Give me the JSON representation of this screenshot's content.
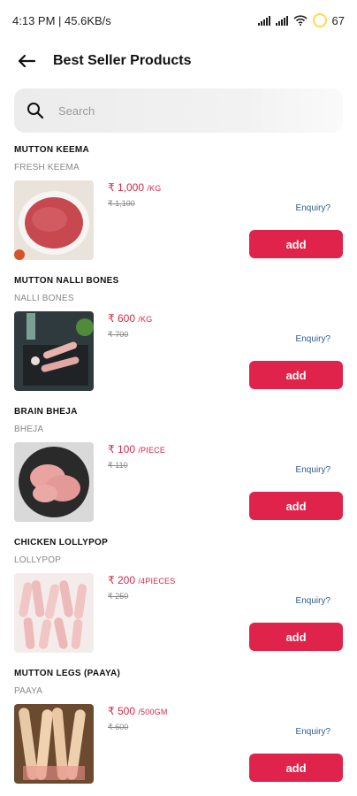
{
  "status_bar": {
    "time_speed": "4:13 PM | 45.6KB/s",
    "battery": "67"
  },
  "header": {
    "title": "Best Seller Products"
  },
  "search": {
    "placeholder": "Search"
  },
  "colors": {
    "accent": "#e0234a",
    "price": "#d72848",
    "link": "#2b5d91"
  },
  "products": [
    {
      "name": "MUTTON KEEMA",
      "subtitle": "FRESH KEEMA",
      "price": "₹ 1,000",
      "unit": "/KG",
      "mrp": "₹ 1,100",
      "enquiry": "Enquiry?",
      "add_label": "add"
    },
    {
      "name": "MUTTON NALLI BONES",
      "subtitle": "NALLI BONES",
      "price": "₹ 600",
      "unit": "/KG",
      "mrp": "₹ 700",
      "enquiry": "Enquiry?",
      "add_label": "add"
    },
    {
      "name": "BRAIN BHEJA",
      "subtitle": "BHEJA",
      "price": "₹ 100",
      "unit": "/PIECE",
      "mrp": "₹ 110",
      "enquiry": "Enquiry?",
      "add_label": "add"
    },
    {
      "name": "CHICKEN LOLLYPOP",
      "subtitle": "LOLLYPOP",
      "price": "₹ 200",
      "unit": "/4PIECES",
      "mrp": "₹ 250",
      "enquiry": "Enquiry?",
      "add_label": "add"
    },
    {
      "name": "MUTTON LEGS (PAAYA)",
      "subtitle": "PAAYA",
      "price": "₹ 500",
      "unit": "/500GM",
      "mrp": "₹ 600",
      "enquiry": "Enquiry?",
      "add_label": "add"
    }
  ]
}
